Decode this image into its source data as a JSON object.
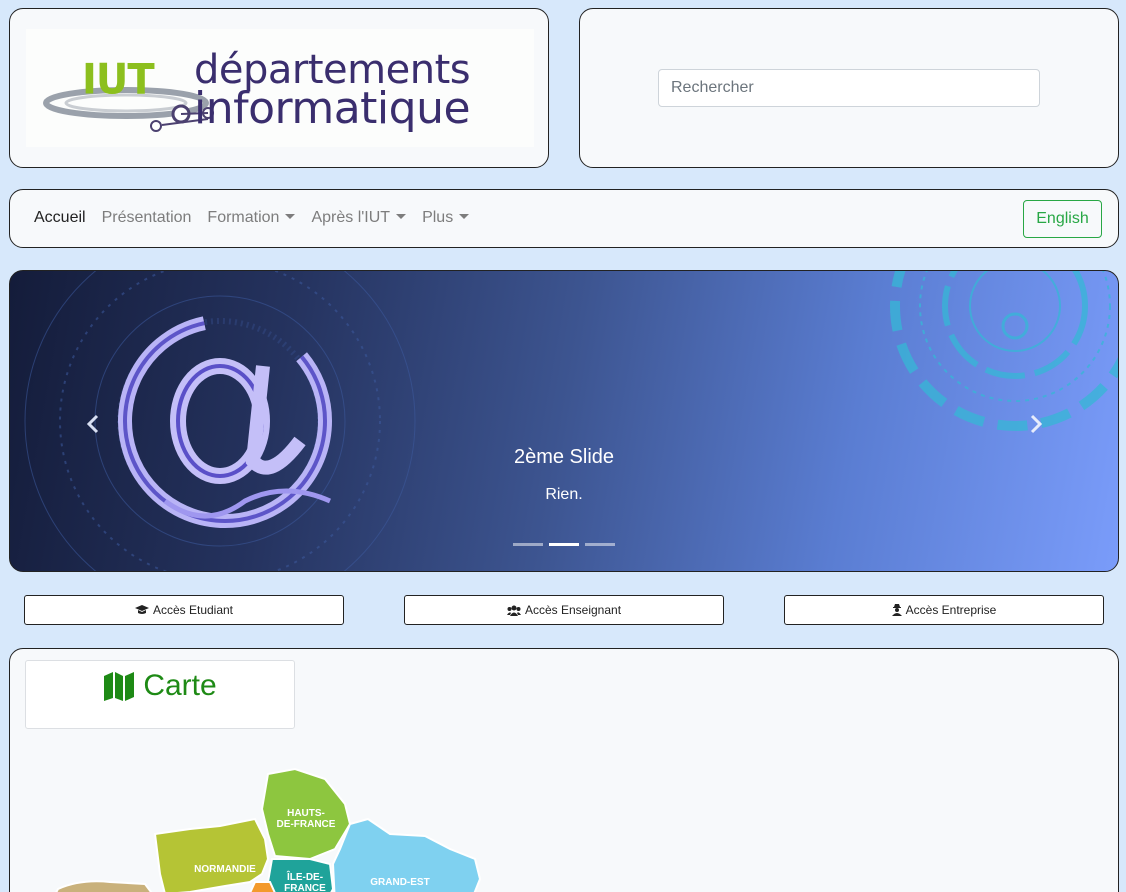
{
  "header": {
    "logo": {
      "brand_short": "IUT",
      "line1": "départements",
      "line2": "informatique"
    },
    "search": {
      "placeholder": "Rechercher"
    }
  },
  "nav": {
    "links": [
      {
        "label": "Accueil",
        "active": true,
        "dropdown": false
      },
      {
        "label": "Présentation",
        "active": false,
        "dropdown": false
      },
      {
        "label": "Formation",
        "active": false,
        "dropdown": true
      },
      {
        "label": "Après l'IUT",
        "active": false,
        "dropdown": true
      },
      {
        "label": "Plus",
        "active": false,
        "dropdown": true
      }
    ],
    "language_button": "English"
  },
  "carousel": {
    "slide_title": "2ème Slide",
    "slide_caption": "Rien.",
    "indicator_count": 3,
    "active_indicator": 1,
    "prev_icon": "chevron-left-icon",
    "next_icon": "chevron-right-icon"
  },
  "access": {
    "etudiant": {
      "label": "Accès Etudiant",
      "icon": "graduation-cap-icon"
    },
    "enseignant": {
      "label": "Accès Enseignant",
      "icon": "users-icon"
    },
    "entreprise": {
      "label": "Accès Entreprise",
      "icon": "user-secret-icon"
    }
  },
  "map": {
    "heading": "Carte",
    "heading_icon": "map-icon",
    "regions": [
      {
        "name": "HAUTS-\nDE-FRANCE",
        "color": "#8dc63f"
      },
      {
        "name": "NORMANDIE",
        "color": "#b5c435"
      },
      {
        "name": "ÎLE-DE-\nFRANCE",
        "color": "#1fa39a"
      },
      {
        "name": "GRAND-EST",
        "color": "#7fd1f0"
      }
    ]
  },
  "colors": {
    "page_bg": "#d7e8fb",
    "panel_bg": "#f7f9fb",
    "accent_green": "#28a745",
    "map_heading": "#1e8a15"
  }
}
